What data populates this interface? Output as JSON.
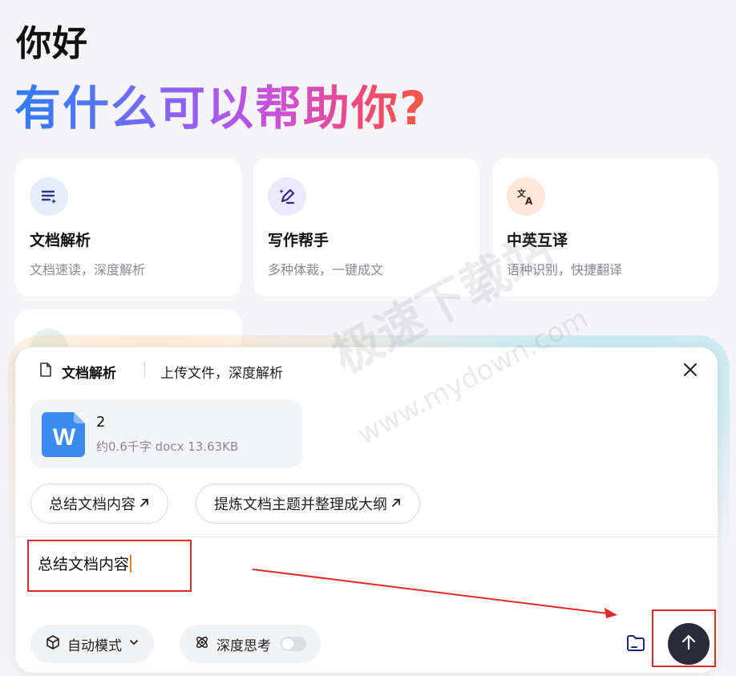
{
  "greeting": "你好",
  "headline": "有什么可以帮助你?",
  "cards": [
    {
      "title": "文档解析",
      "subtitle": "文档速读，深度解析",
      "icon": "document-lines-icon",
      "bg": "#e6eefc"
    },
    {
      "title": "写作帮手",
      "subtitle": "多种体裁，一键成文",
      "icon": "pen-sparkle-icon",
      "bg": "#ebe9fb"
    },
    {
      "title": "中英互译",
      "subtitle": "语种识别，快捷翻译",
      "icon": "translate-icon",
      "bg": "#fde7da"
    }
  ],
  "panel": {
    "mode_label": "文档解析",
    "mode_sub": "上传文件，深度解析",
    "file": {
      "name": "2",
      "meta": "约0.6千字  docx  13.63KB",
      "icon": "word-file-icon",
      "icon_color": "#3b8bf0"
    },
    "suggestions": [
      "总结文档内容",
      "提炼文档主题并整理成大纲"
    ],
    "input_value": "总结文档内容",
    "mode_select": "自动模式",
    "deep_think_label": "深度思考"
  },
  "watermark": {
    "cn": "极速下载站",
    "url": "www.mydown.com"
  },
  "colors": {
    "accent_dark": "#2a2a3a",
    "highlight_red": "#e02a2a"
  }
}
